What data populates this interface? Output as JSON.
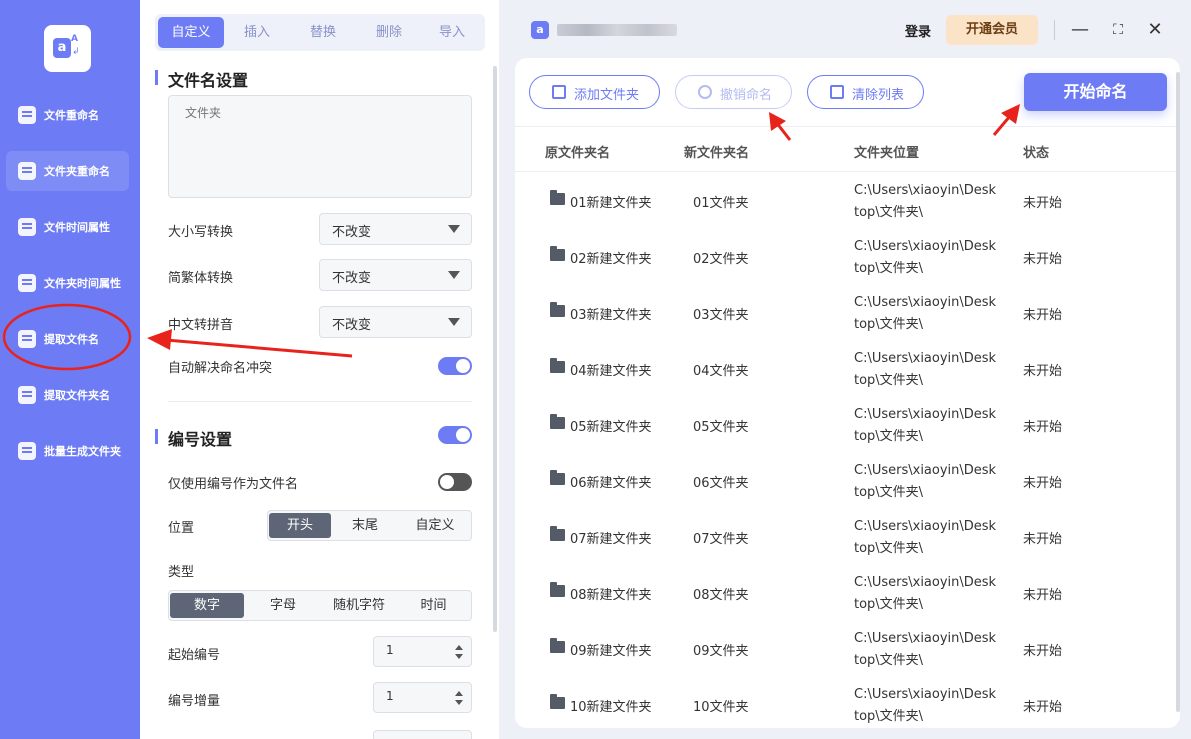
{
  "sidebar": {
    "items": [
      {
        "label": "文件重命名"
      },
      {
        "label": "文件夹重命名"
      },
      {
        "label": "文件时间属性"
      },
      {
        "label": "文件夹时间属性"
      },
      {
        "label": "提取文件名"
      },
      {
        "label": "提取文件夹名"
      },
      {
        "label": "批量生成文件夹"
      }
    ],
    "active_index": 1
  },
  "panel": {
    "tabs": [
      "自定义",
      "插入",
      "替换",
      "删除",
      "导入"
    ],
    "filename_section": {
      "title": "文件名设置",
      "textarea_placeholder": "文件夹",
      "case_label": "大小写转换",
      "case_value": "不改变",
      "trad_label": "简繁体转换",
      "trad_value": "不改变",
      "pinyin_label": "中文转拼音",
      "pinyin_value": "不改变",
      "conflict_label": "自动解决命名冲突",
      "conflict_on": true
    },
    "number_section": {
      "title": "编号设置",
      "enabled": true,
      "only_number_label": "仅使用编号作为文件名",
      "only_number_on": false,
      "position_label": "位置",
      "position_options": [
        "开头",
        "末尾",
        "自定义"
      ],
      "position_selected": "开头",
      "type_label": "类型",
      "type_options": [
        "数字",
        "字母",
        "随机字符",
        "时间"
      ],
      "type_selected": "数字",
      "start_label": "起始编号",
      "start_value": "1",
      "step_label": "编号增量",
      "step_value": "1"
    }
  },
  "topbar": {
    "login_label": "登录",
    "vip_label": "开通会员",
    "window_controls": [
      "—",
      "⛶",
      "✕"
    ]
  },
  "toolbar": {
    "add_label": "添加文件夹",
    "undo_label": "撤销命名",
    "clear_label": "清除列表",
    "start_label": "开始命名"
  },
  "table": {
    "headers": [
      "原文件夹名",
      "新文件夹名",
      "文件夹位置",
      "状态"
    ],
    "rows": [
      {
        "orig": "01新建文件夹",
        "new": "01文件夹",
        "loc1": "C:\\Users\\xiaoyin\\Desk",
        "loc2": "top\\文件夹\\",
        "status": "未开始"
      },
      {
        "orig": "02新建文件夹",
        "new": "02文件夹",
        "loc1": "C:\\Users\\xiaoyin\\Desk",
        "loc2": "top\\文件夹\\",
        "status": "未开始"
      },
      {
        "orig": "03新建文件夹",
        "new": "03文件夹",
        "loc1": "C:\\Users\\xiaoyin\\Desk",
        "loc2": "top\\文件夹\\",
        "status": "未开始"
      },
      {
        "orig": "04新建文件夹",
        "new": "04文件夹",
        "loc1": "C:\\Users\\xiaoyin\\Desk",
        "loc2": "top\\文件夹\\",
        "status": "未开始"
      },
      {
        "orig": "05新建文件夹",
        "new": "05文件夹",
        "loc1": "C:\\Users\\xiaoyin\\Desk",
        "loc2": "top\\文件夹\\",
        "status": "未开始"
      },
      {
        "orig": "06新建文件夹",
        "new": "06文件夹",
        "loc1": "C:\\Users\\xiaoyin\\Desk",
        "loc2": "top\\文件夹\\",
        "status": "未开始"
      },
      {
        "orig": "07新建文件夹",
        "new": "07文件夹",
        "loc1": "C:\\Users\\xiaoyin\\Desk",
        "loc2": "top\\文件夹\\",
        "status": "未开始"
      },
      {
        "orig": "08新建文件夹",
        "new": "08文件夹",
        "loc1": "C:\\Users\\xiaoyin\\Desk",
        "loc2": "top\\文件夹\\",
        "status": "未开始"
      },
      {
        "orig": "09新建文件夹",
        "new": "09文件夹",
        "loc1": "C:\\Users\\xiaoyin\\Desk",
        "loc2": "top\\文件夹\\",
        "status": "未开始"
      },
      {
        "orig": "10新建文件夹",
        "new": "10文件夹",
        "loc1": "C:\\Users\\xiaoyin\\Desk",
        "loc2": "top\\文件夹\\",
        "status": "未开始"
      }
    ]
  },
  "colors": {
    "accent": "#6d7cf4",
    "vip_bg": "#fbe3c7",
    "annotation_red": "#e8231b"
  }
}
